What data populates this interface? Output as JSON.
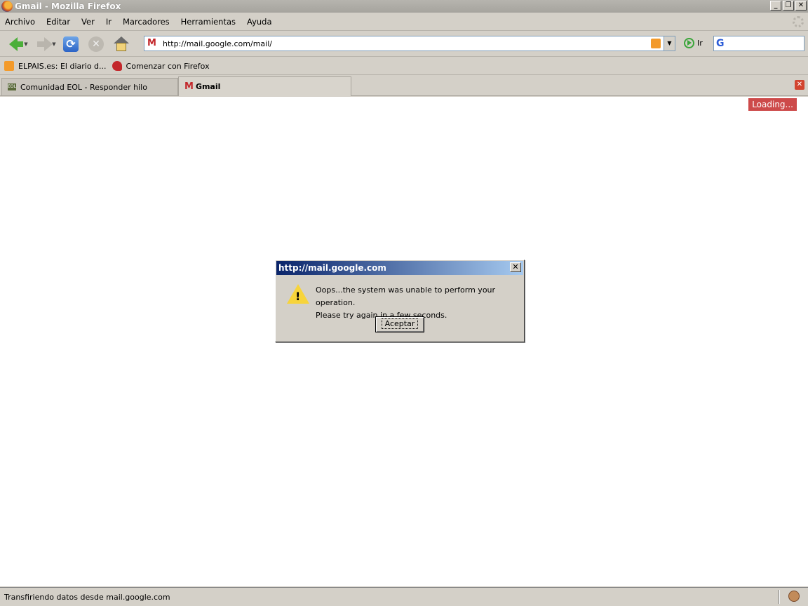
{
  "window": {
    "title": "Gmail - Mozilla Firefox"
  },
  "menu": {
    "items": [
      "Archivo",
      "Editar",
      "Ver",
      "Ir",
      "Marcadores",
      "Herramientas",
      "Ayuda"
    ]
  },
  "nav": {
    "url": "http://mail.google.com/mail/",
    "go_label": "Ir"
  },
  "bookmarks": {
    "items": [
      "ELPAIS.es: El diario d...",
      "Comenzar con Firefox"
    ]
  },
  "tabs": [
    {
      "label": "Comunidad EOL - Responder hilo"
    },
    {
      "label": "Gmail"
    }
  ],
  "content": {
    "loading_label": "Loading..."
  },
  "dialog": {
    "title": "http://mail.google.com",
    "message_line1": "Oops...the system was unable to perform your operation.",
    "message_line2": "Please try again in a few seconds.",
    "button": "Aceptar"
  },
  "status": {
    "text": "Transfiriendo datos desde mail.google.com"
  }
}
